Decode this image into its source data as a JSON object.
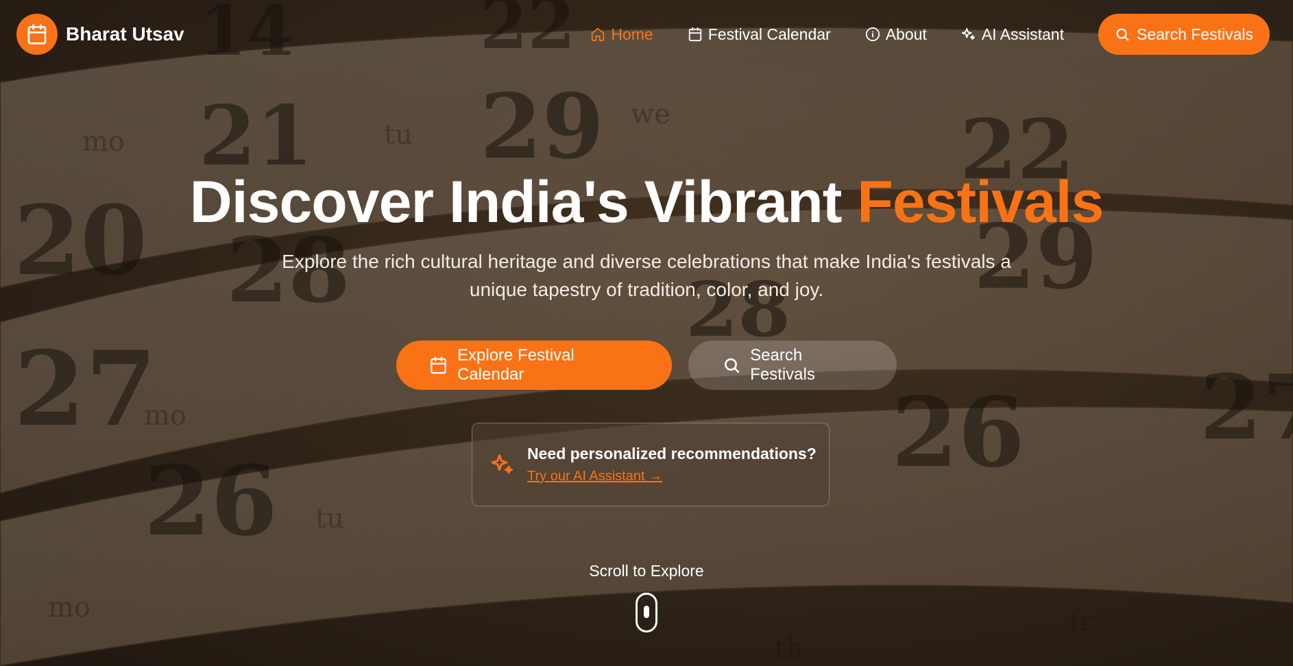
{
  "brand": {
    "name": "Bharat Utsav"
  },
  "nav": {
    "items": [
      {
        "label": "Home",
        "icon": "home-icon",
        "active": true
      },
      {
        "label": "Festival Calendar",
        "icon": "calendar-icon"
      },
      {
        "label": "About",
        "icon": "info-icon"
      },
      {
        "label": "AI Assistant",
        "icon": "sparkles-icon"
      }
    ],
    "cta_label": "Search Festivals"
  },
  "hero": {
    "title_main": "Discover India's Vibrant",
    "title_accent": "Festivals",
    "subtitle": "Explore the rich cultural heritage and diverse celebrations that make India's festivals a unique tapestry of tradition, color, and joy.",
    "primary_button": "Explore Festival Calendar",
    "secondary_button": "Search Festivals"
  },
  "ai_card": {
    "title": "Need personalized recommendations?",
    "link": "Try our AI Assistant →"
  },
  "scroll": {
    "label": "Scroll to Explore"
  },
  "colors": {
    "accent": "#f97316"
  }
}
